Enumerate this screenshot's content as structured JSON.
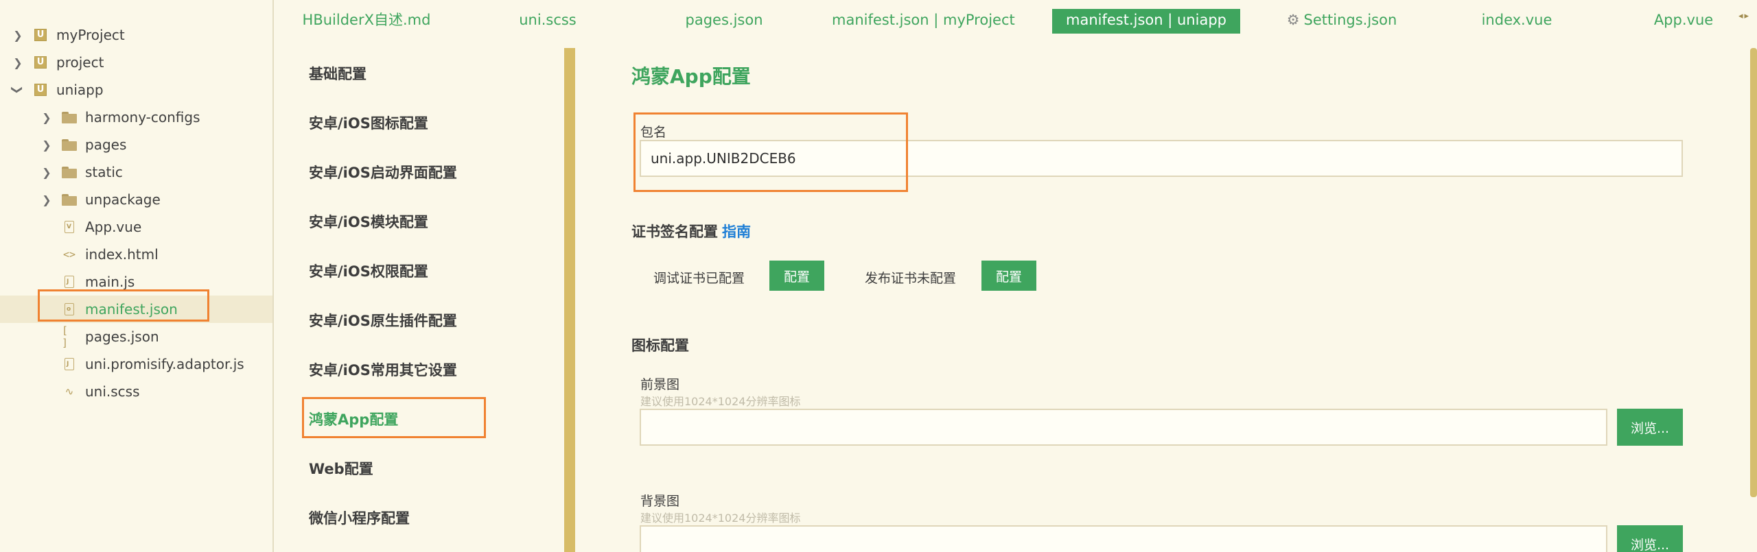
{
  "tree": {
    "items": [
      {
        "label": "myProject",
        "kind": "project",
        "expanded": false
      },
      {
        "label": "project",
        "kind": "project",
        "expanded": false
      },
      {
        "label": "uniapp",
        "kind": "project",
        "expanded": true
      },
      {
        "label": "harmony-configs",
        "kind": "folder"
      },
      {
        "label": "pages",
        "kind": "folder"
      },
      {
        "label": "static",
        "kind": "folder"
      },
      {
        "label": "unpackage",
        "kind": "folder"
      },
      {
        "label": "App.vue",
        "kind": "vue"
      },
      {
        "label": "index.html",
        "kind": "html"
      },
      {
        "label": "main.js",
        "kind": "js"
      },
      {
        "label": "manifest.json",
        "kind": "manifest",
        "selected": true
      },
      {
        "label": "pages.json",
        "kind": "json"
      },
      {
        "label": "uni.promisify.adaptor.js",
        "kind": "js"
      },
      {
        "label": "uni.scss",
        "kind": "scss"
      }
    ]
  },
  "tabs": [
    {
      "label": "HBuilderX自述.md"
    },
    {
      "label": "uni.scss"
    },
    {
      "label": "pages.json"
    },
    {
      "label": "manifest.json | myProject"
    },
    {
      "label": "manifest.json | uniapp",
      "active": true
    },
    {
      "label": "Settings.json",
      "icon": "gear-icon"
    },
    {
      "label": "index.vue"
    },
    {
      "label": "App.vue"
    }
  ],
  "nav": {
    "items": [
      {
        "label": "基础配置"
      },
      {
        "label": "安卓/iOS图标配置"
      },
      {
        "label": "安卓/iOS启动界面配置"
      },
      {
        "label": "安卓/iOS模块配置"
      },
      {
        "label": "安卓/iOS权限配置"
      },
      {
        "label": "安卓/iOS原生插件配置"
      },
      {
        "label": "安卓/iOS常用其它设置"
      },
      {
        "label": "鸿蒙App配置",
        "active": true
      },
      {
        "label": "Web配置"
      },
      {
        "label": "微信小程序配置"
      }
    ]
  },
  "main": {
    "title": "鸿蒙App配置",
    "package": {
      "label": "包名",
      "value": "uni.app.UNIB2DCEB6"
    },
    "cert": {
      "title": "证书签名配置",
      "guide_link": "指南",
      "debug_status": "调试证书已配置",
      "debug_button": "配置",
      "release_status": "发布证书未配置",
      "release_button": "配置"
    },
    "icon_config": {
      "title": "图标配置",
      "foreground_label": "前景图",
      "foreground_hint": "建议使用1024*1024分辨率图标",
      "foreground_value": "",
      "foreground_browse": "浏览...",
      "background_label": "背景图",
      "background_hint": "建议使用1024*1024分辨率图标",
      "background_value": "",
      "background_browse": "浏览..."
    }
  },
  "colors": {
    "accent": "#3fa55e",
    "highlight": "#f08231",
    "background": "#fbf8e9",
    "link": "#1f7fd6"
  }
}
